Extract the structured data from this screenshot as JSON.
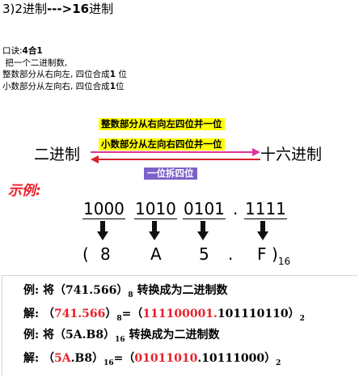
{
  "heading": {
    "prefix": "3)2进制",
    "arrow": "--->16",
    "suffix": "进制"
  },
  "notes": {
    "rhyme_label": "口诀:",
    "rhyme_value": "4合1",
    "line1": "把一个二进制数,",
    "line2_text": "整数部分从右向左, 四位合成",
    "line2_num": "1",
    "line2_tail": "位",
    "line3_text": "小数部分从左向右, 四位合成",
    "line3_num": "1",
    "line3_tail": "位"
  },
  "diagram": {
    "integer_rule": "整数部分从右向左四位并一位",
    "fraction_rule": "小数部分从左向右四位并一位",
    "left_base": "二进制",
    "right_base": "十六进制",
    "reverse_rule": "一位拆四位",
    "example_title": "示例:",
    "groups": [
      "1000",
      "1010",
      "0101",
      ".",
      "1111"
    ],
    "open_paren": "(",
    "hex_digits": [
      "8",
      "A",
      "5",
      ".",
      "F"
    ],
    "close_paren": ")",
    "result_base": "16",
    "colors": {
      "highlight": "#ffff00",
      "arrow_top": "#e0309a",
      "arrow_bottom": "#d8202a",
      "bar": "#7b62c9",
      "example": "#e8202a"
    }
  },
  "examples": {
    "ex1_label": "例:",
    "ex1_text_a": "将（741.566）",
    "ex1_sub": "8",
    "ex1_text_b": "转换成为二进制数",
    "sol1_label": "解:",
    "sol1_open": "（",
    "sol1_red": "741.566",
    "sol1_close": "）",
    "sol1_sub": "8",
    "sol1_eq": "=（",
    "sol1_red2": "111100001.",
    "sol1_blue": "101110110",
    "sol1_end": "）",
    "sol1_sub2": "2",
    "ex2_label": "例:",
    "ex2_text_a": "将（5A.B8）",
    "ex2_sub": "16",
    "ex2_text_b": "转换成为二进制数",
    "sol2_label": "解:",
    "sol2_open": "（",
    "sol2_red": "5A",
    "sol2_mid": ".B8）",
    "sol2_sub": "16",
    "sol2_eq": "=（",
    "sol2_red2": "01011010",
    "sol2_blue": ".10111000",
    "sol2_end": "）",
    "sol2_sub2": "2"
  }
}
